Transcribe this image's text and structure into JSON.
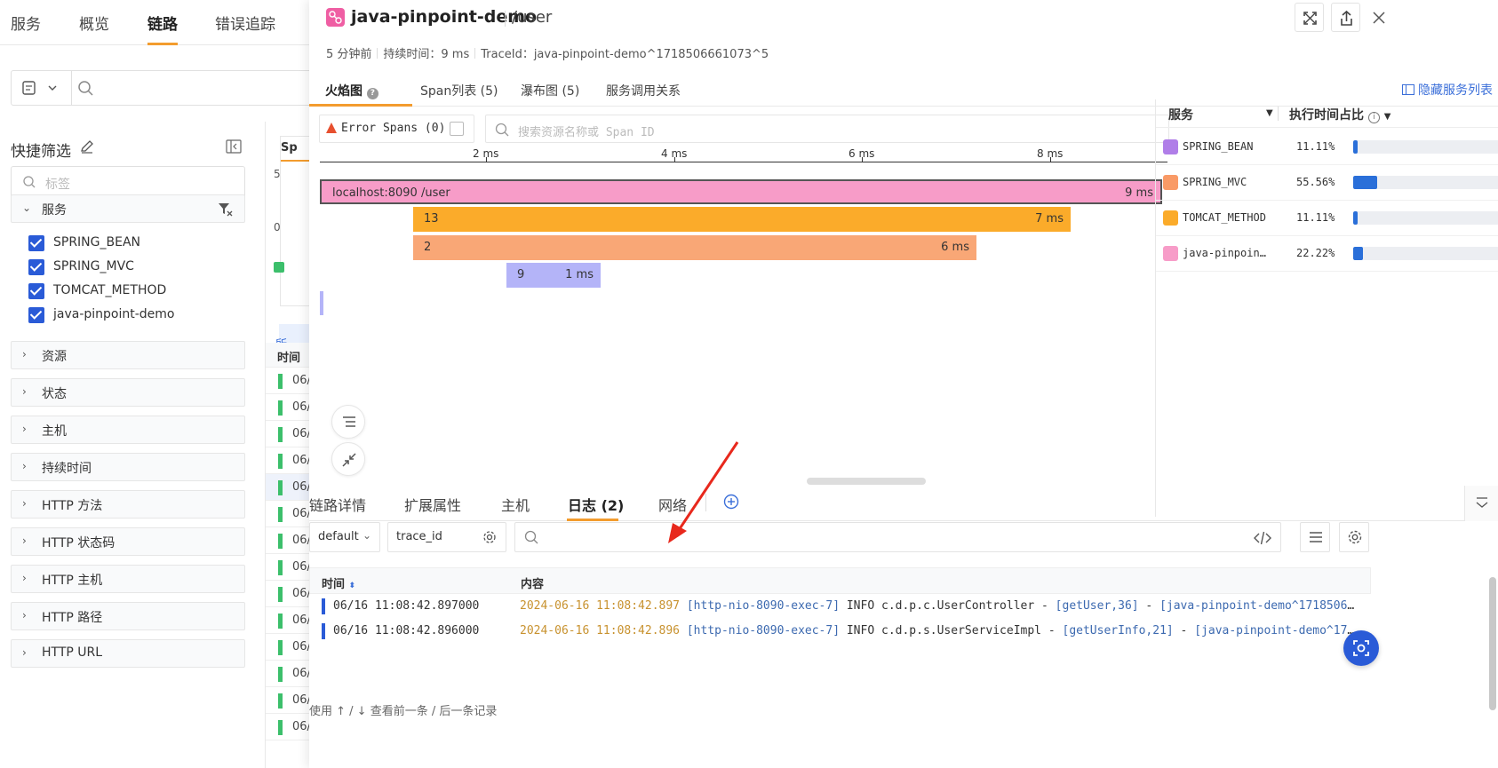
{
  "bg": {
    "nav_tabs": [
      "服务",
      "概览",
      "链路",
      "错误追踪"
    ],
    "quick_filter_title": "快捷筛选",
    "tag_placeholder": "标签",
    "groups": [
      "服务",
      "资源",
      "状态",
      "主机",
      "持续时间",
      "HTTP 方法",
      "HTTP 状态码",
      "HTTP 主机",
      "HTTP 路径",
      "HTTP URL"
    ],
    "services": [
      "SPRING_BEAN",
      "SPRING_MVC",
      "TOMCAT_METHOD",
      "java-pinpoint-demo"
    ],
    "card_num_top": "5",
    "card_num_bottom": "0",
    "card_label": "Sp",
    "blue_bar_text": "所",
    "table_header": "时间",
    "row_prefix": "06/"
  },
  "drawer": {
    "title": "java-pinpoint-demo",
    "path": "/user",
    "meta_time": "5 分钟前",
    "meta_duration": "持续时间：9 ms",
    "meta_trace": "TraceId：java-pinpoint-demo^1718506661073^5",
    "tabs": [
      "火焰图",
      "Span列表 (5)",
      "瀑布图 (5)",
      "服务调用关系"
    ],
    "hide_services": "隐藏服务列表"
  },
  "flame": {
    "error_spans_label": "Error Spans (0)",
    "search_placeholder": "搜索资源名称或 Span ID",
    "ticks": [
      "2 ms",
      "4 ms",
      "6 ms",
      "8 ms"
    ],
    "bars": [
      {
        "label": "localhost:8090 /user",
        "dur": "9 ms",
        "color": "#f79cc8"
      },
      {
        "label": "13",
        "dur": "7 ms",
        "color": "#fbab2a"
      },
      {
        "label": "2",
        "dur": "6 ms",
        "color": "#f9a776"
      },
      {
        "label": "9",
        "dur": "1 ms",
        "color": "#b4b4f8"
      }
    ]
  },
  "services_panel": {
    "col_service": "服务",
    "col_ratio": "执行时间占比",
    "rows": [
      {
        "name": "SPRING_BEAN",
        "pct": "11.11%",
        "ratio": 0.1111,
        "color": "#b07ee8"
      },
      {
        "name": "SPRING_MVC",
        "pct": "55.56%",
        "ratio": 0.5556,
        "color": "#f99a66"
      },
      {
        "name": "TOMCAT_METHOD",
        "pct": "11.11%",
        "ratio": 0.1111,
        "color": "#fbab2a"
      },
      {
        "name": "java-pinpoin…",
        "pct": "22.22%",
        "ratio": 0.2222,
        "color": "#f79cc8"
      }
    ]
  },
  "bottom": {
    "tabs": [
      "链路详情",
      "扩展属性",
      "主机",
      "日志 (2)",
      "网络"
    ],
    "index_select": "default",
    "field_select": "trace_id",
    "col_time": "时间",
    "col_content": "内容",
    "logs": [
      {
        "time": "06/16 11:08:42.897000",
        "date": "2024-06-16 11:08:42.897",
        "thread": "[http-nio-8090-exec-7]",
        "body": "INFO c.d.p.c.UserController - ",
        "method": "[getUser,36]",
        "sep": " - ",
        "trace": "[java-pinpoint-demo^17185066610..."
      },
      {
        "time": "06/16 11:08:42.896000",
        "date": "2024-06-16 11:08:42.896",
        "thread": "[http-nio-8090-exec-7]",
        "body": "INFO c.d.p.s.UserServiceImpl - ",
        "method": "[getUserInfo,21]",
        "sep": " - ",
        "trace": "[java-pinpoint-demo^171850..."
      }
    ],
    "pager": "使用 ↑ / ↓ 查看前一条 / 后一条记录"
  },
  "colors": {
    "accent": "#f39c2e",
    "primary": "#2a5bd7",
    "annotation": "#e8281c"
  }
}
